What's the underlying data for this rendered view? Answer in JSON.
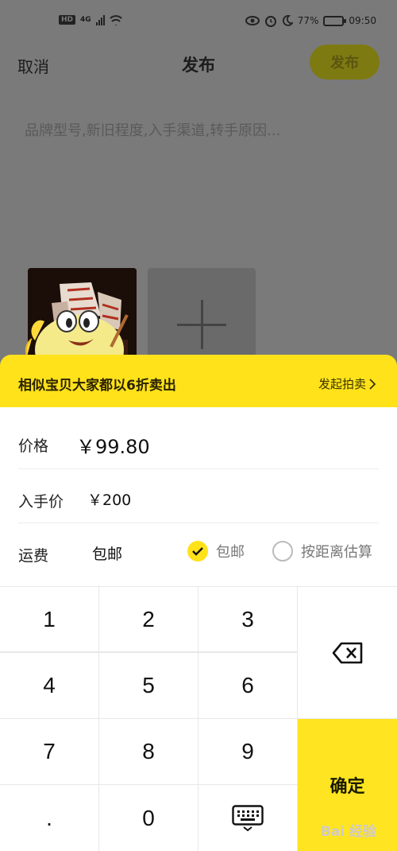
{
  "status_bar": {
    "hd": "HD",
    "network": "4G",
    "battery_pct": "77%",
    "time": "09:50"
  },
  "header": {
    "cancel": "取消",
    "title": "发布",
    "publish": "发布"
  },
  "description_placeholder": "品牌型号,新旧程度,入手渠道,转手原因...",
  "banner": {
    "text": "相似宝贝大家都以6折卖出",
    "link": "发起拍卖"
  },
  "form": {
    "price_label": "价格",
    "price_value": "￥99.80",
    "original_price_label": "入手价",
    "original_price_value": "￥200",
    "shipping_label": "运费",
    "shipping_value": "包邮",
    "option_free": "包邮",
    "option_distance": "按距离估算"
  },
  "keypad": {
    "k1": "1",
    "k2": "2",
    "k3": "3",
    "k4": "4",
    "k5": "5",
    "k6": "6",
    "k7": "7",
    "k8": "8",
    "k9": "9",
    "dot": ".",
    "k0": "0",
    "confirm": "确定"
  },
  "watermark": "Bai 经验",
  "colors": {
    "accent": "#ffe21a",
    "overlay": "#7a7a7a"
  }
}
